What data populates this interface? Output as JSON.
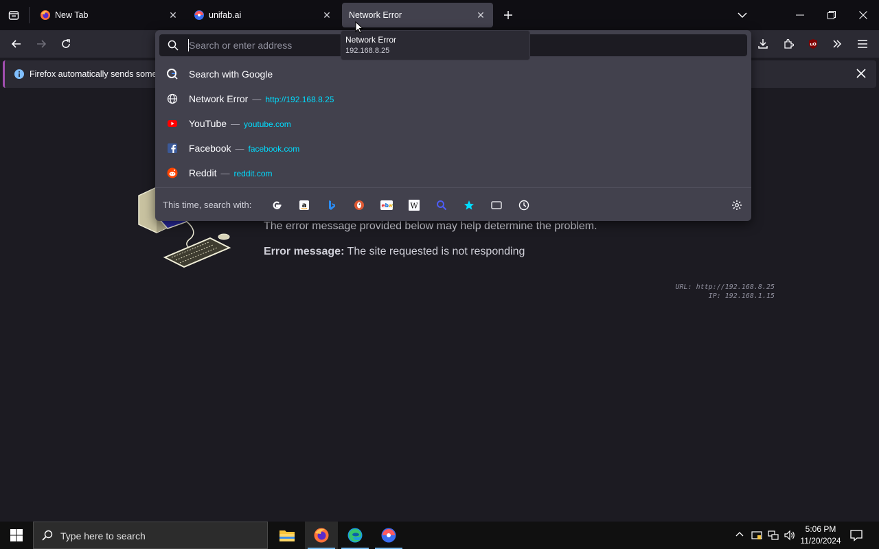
{
  "tabs": [
    {
      "title": "New Tab"
    },
    {
      "title": "unifab.ai"
    },
    {
      "title": "Network Error"
    }
  ],
  "tooltip": {
    "title": "Network Error",
    "subtitle": "192.168.8.25"
  },
  "urlbar": {
    "placeholder": "Search or enter address"
  },
  "notification": {
    "text": "Firefox automatically sends some d"
  },
  "suggestions": [
    {
      "label": "Search with Google",
      "url": ""
    },
    {
      "label": "Network Error",
      "url": "http://192.168.8.25"
    },
    {
      "label": "YouTube",
      "url": "youtube.com"
    },
    {
      "label": "Facebook",
      "url": "facebook.com"
    },
    {
      "label": "Reddit",
      "url": "reddit.com"
    }
  ],
  "dash": "—",
  "search_with": {
    "label": "This time, search with:",
    "engines": [
      "Google",
      "Amazon",
      "Bing",
      "DuckDuckGo",
      "eBay",
      "Wikipedia",
      "Search",
      "Bookmarks",
      "Tabs",
      "History"
    ]
  },
  "error_page": {
    "line1": "The error message provided below may help determine the problem.",
    "message_label": "Error message:",
    "message_text": "The site requested is not responding",
    "url_line": "URL: http://192.168.8.25",
    "ip_line": "IP: 192.168.1.15"
  },
  "taskbar": {
    "search_placeholder": "Type here to search",
    "time": "5:06 PM",
    "date": "11/20/2024"
  },
  "colors": {
    "url_link": "#00ddff",
    "accent": "#a14eb0",
    "taskbar_indicator": "#76b9ed"
  }
}
